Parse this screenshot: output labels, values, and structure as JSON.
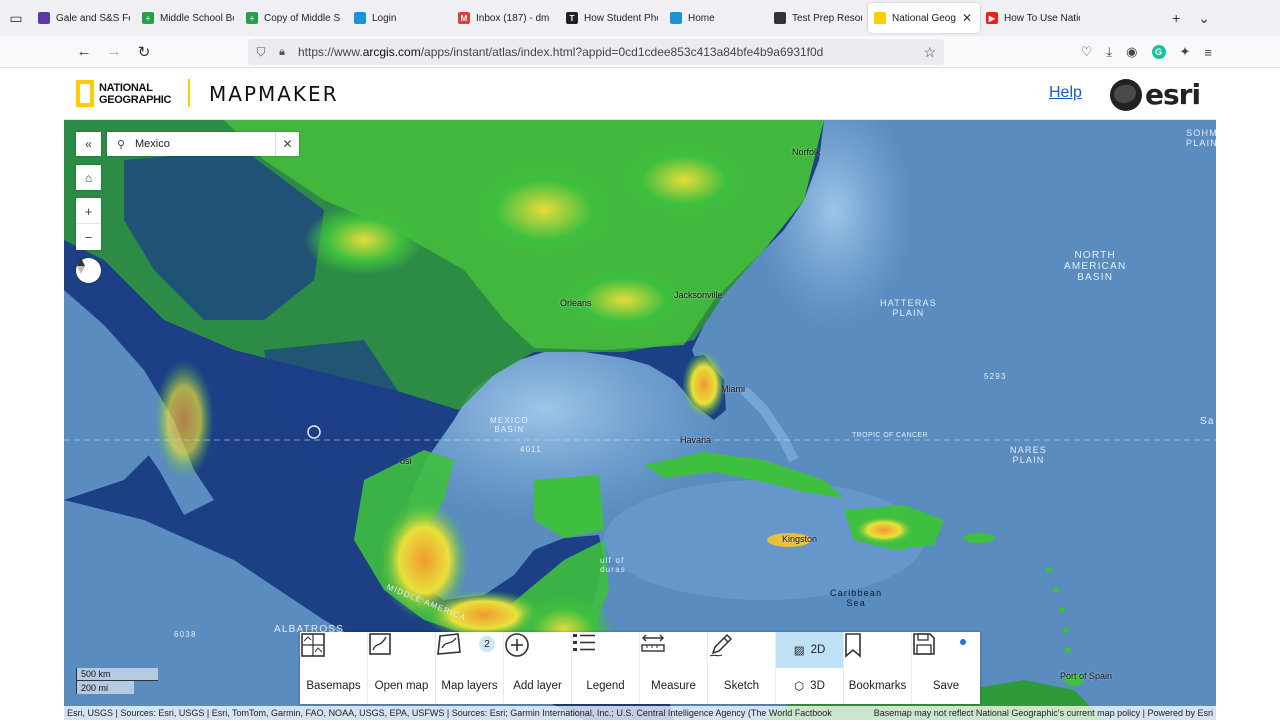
{
  "browser": {
    "tabs": [
      {
        "title": "Gale and S&S Fe",
        "color": "#5b3aa8",
        "glyph": ""
      },
      {
        "title": "Middle School Bo",
        "color": "#22a04a",
        "glyph": "+"
      },
      {
        "title": "Copy of Middle S",
        "color": "#22a04a",
        "glyph": "+"
      },
      {
        "title": "Login",
        "color": "#1e90d6",
        "glyph": ""
      },
      {
        "title": "Inbox (187) - dm",
        "color": "#d44638",
        "glyph": "M"
      },
      {
        "title": "How Student Pho",
        "color": "#222222",
        "glyph": "T"
      },
      {
        "title": "Home",
        "color": "#1e90d6",
        "glyph": ""
      },
      {
        "title": "Test Prep Resour",
        "color": "#333333",
        "glyph": ""
      },
      {
        "title": "National Geog",
        "color": "#ffce00",
        "glyph": ""
      },
      {
        "title": "How To Use Natio",
        "color": "#e62117",
        "glyph": "▶"
      }
    ],
    "active_tab_index": 8,
    "url_prefix": "https://www.",
    "url_host": "arcgis.com",
    "url_path": "/apps/instant/atlas/index.html?appid=0cd1cdee853c413a84bfe4b9a6931f0d"
  },
  "app": {
    "brand_line1": "NATIONAL",
    "brand_line2": "GEOGRAPHIC",
    "title": "MAPMAKER",
    "help_label": "Help",
    "esri_label": "esri"
  },
  "search": {
    "value": "Mexico"
  },
  "map_labels": {
    "norfolk": "Norfolk",
    "new_orleans": "Orleans",
    "jacksonville": "Jacksonville",
    "miami": "Miami",
    "havana": "Havana",
    "kingston": "Kingston",
    "port_of_spain": "Port of Spain",
    "mexico_basin": "MEXICO\nBASIN",
    "depth_4011": "4011",
    "depth_5293": "5293",
    "depth_6038": "6038",
    "tropic": "TROPIC OF CANCER",
    "hatteras": "HATTERAS\nPLAIN",
    "north_american_basin": "NORTH\nAMERICAN\nBASIN",
    "sohm": "SOHM\nPLAIN",
    "nares": "NARES\nPLAIN",
    "caribbean": "Caribbean\nSea",
    "albatross": "ALBATROSS",
    "middle_america": "MIDDLE AMERICA",
    "potosi": "osi",
    "gulf_honduras": "ulf of\nduras",
    "sa": "Sa"
  },
  "toolbar": {
    "basemaps": "Basemaps",
    "open_map": "Open map",
    "map_layers": "Map layers",
    "map_layers_count": "2",
    "add_layer": "Add layer",
    "legend": "Legend",
    "measure": "Measure",
    "sketch": "Sketch",
    "view_2d": "2D",
    "view_3d": "3D",
    "bookmarks": "Bookmarks",
    "save": "Save"
  },
  "scale": {
    "metric": "500 km",
    "imperial": "200 mi"
  },
  "attribution": {
    "left": "Esri, USGS | Sources: Esri, USGS | Esri, TomTom, Garmin, FAO, NOAA, USGS, EPA, USFWS | Sources: Esri; Garmin International, Inc.; U.S. Central Intelligence Agency (The World Factbook)",
    "right": "Basemap may not reflect National Geographic's current map policy | Powered by Esri"
  },
  "colors": {
    "ocean": "#5a8cc0",
    "land_low": "#1a3d8a",
    "land_green": "#3fbf3f",
    "land_yellow": "#e8e13a",
    "land_orange": "#f0a030",
    "accent_active": "#bfe1f6",
    "brand_yellow": "#ffce00"
  }
}
